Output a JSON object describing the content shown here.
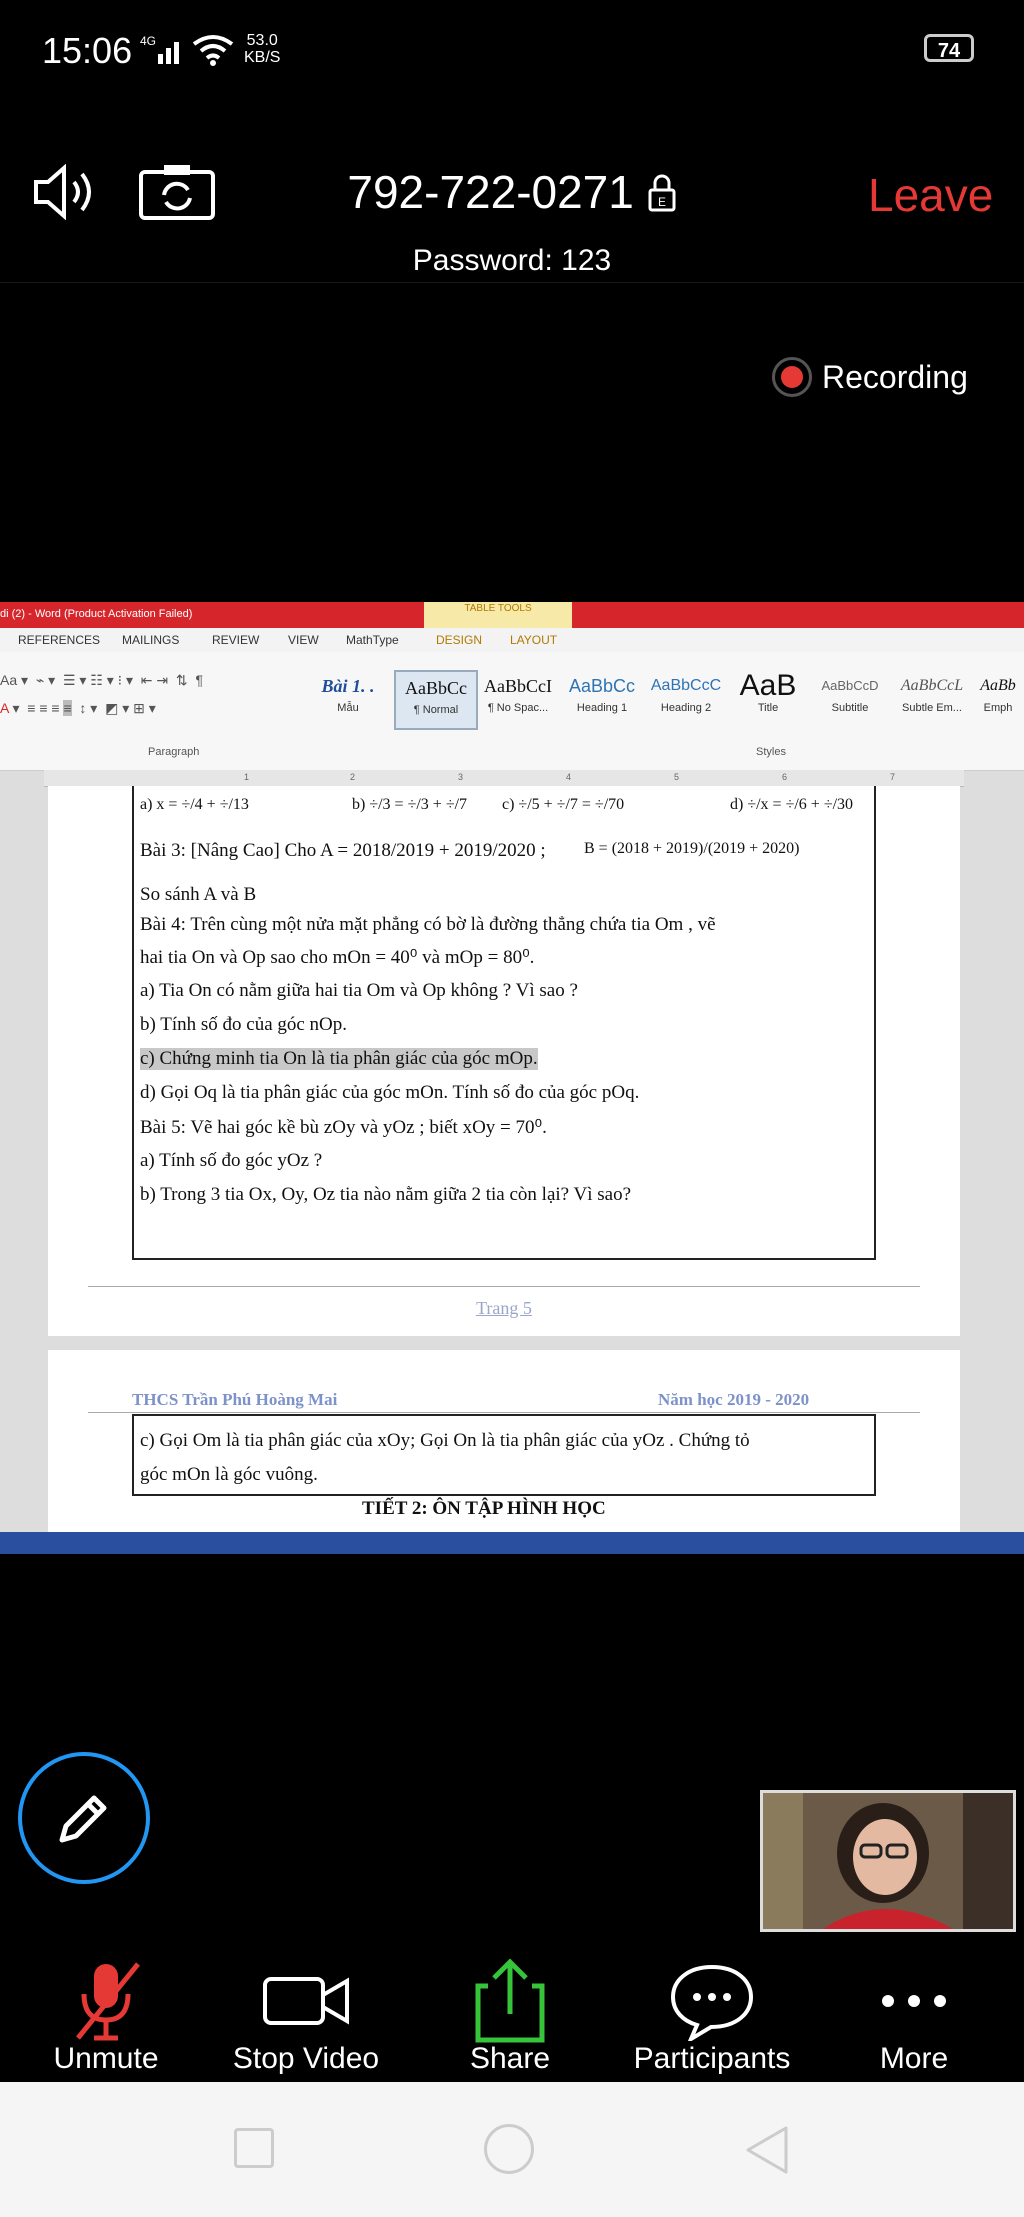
{
  "status_bar": {
    "time": "15:06",
    "signal": "4G",
    "net_speed_value": "53.0",
    "net_speed_unit": "KB/S",
    "battery": "74"
  },
  "meeting": {
    "id": "792-722-0271",
    "password": "Password: 123",
    "leave_label": "Leave",
    "recording_label": "Recording"
  },
  "word": {
    "title": "di (2) - Word (Product Activation Failed)",
    "table_tools": "TABLE TOOLS",
    "tabs": [
      "REFERENCES",
      "MAILINGS",
      "REVIEW",
      "VIEW",
      "MathType",
      "DESIGN",
      "LAYOUT"
    ],
    "paragraph_label": "Paragraph",
    "styles_label": "Styles",
    "styles": [
      {
        "preview": "Bài 1. .",
        "name": "Mẫu"
      },
      {
        "preview": "AaBbCc",
        "name": "¶ Normal"
      },
      {
        "preview": "AaBbCcI",
        "name": "¶ No Spac..."
      },
      {
        "preview": "AaBbCc",
        "name": "Heading 1"
      },
      {
        "preview": "AaBbCcC",
        "name": "Heading 2"
      },
      {
        "preview": "AaB",
        "name": "Title"
      },
      {
        "preview": "AaBbCcD",
        "name": "Subtitle"
      },
      {
        "preview": "AaBbCcL",
        "name": "Subtle Em..."
      },
      {
        "preview": "AaBb",
        "name": "Emph"
      }
    ],
    "ruler_numbers": [
      "1",
      "2",
      "3",
      "4",
      "5",
      "6",
      "7"
    ]
  },
  "document": {
    "row_a": "a) x = ÷/4 + ÷/13",
    "row_b": "b) ÷/3 = ÷/3 + ÷/7",
    "row_c": "c) ÷/5 + ÷/7 = ÷/70",
    "row_d": "d) ÷/x = ÷/6 + ÷/30",
    "bai3": "Bài 3: [Nâng Cao] Cho A = 2018/2019 + 2019/2020 ;",
    "bai3_b": "B = (2018 + 2019)/(2019 + 2020)",
    "so_sanh": "So sánh A và B",
    "bai4": "Bài 4: Trên cùng một nửa mặt phẳng có bờ là đường thẳng chứa tia Om , vẽ",
    "bai4_2": "hai tia On  và Op  sao cho  mOn = 40⁰  và  mOp = 80⁰.",
    "a4": "a) Tia On  có nằm giữa hai tia Om và Op không ? Vì sao ?",
    "b4": "b) Tính số đo của góc nOp.",
    "c4": "c) Chứng minh tia On  là tia phân giác của góc mOp.",
    "d4": "d) Gọi Oq  là tia phân giác của góc mOn. Tính số đo của góc pOq.",
    "bai5": "Bài 5: Vẽ hai góc kề bù  zOy và yOz ; biết  xOy = 70⁰.",
    "a5": "a) Tính số đo góc yOz ?",
    "b5": "b) Trong 3 tia Ox, Oy, Oz tia nào nằm giữa 2 tia còn lại? Vì sao?",
    "page_label": "Trang 5",
    "header_left": "THCS Trần Phú Hoàng Mai",
    "header_right": "Năm học 2019 - 2020",
    "p2_line1": "c) Gọi Om  là tia phân giác của xOy; Gọi On là tia phân giác của  yOz . Chứng tỏ",
    "p2_line2": "góc mOn là góc vuông.",
    "p2_heading": "TIẾT 2:  ÔN TẬP HÌNH HỌC"
  },
  "toolbar": {
    "unmute": "Unmute",
    "stop_video": "Stop Video",
    "share": "Share",
    "participants": "Participants",
    "more": "More"
  },
  "colors": {
    "leave": "#e53935",
    "share": "#35c43a",
    "unmute": "#e53935",
    "annotate": "#2196f3"
  }
}
